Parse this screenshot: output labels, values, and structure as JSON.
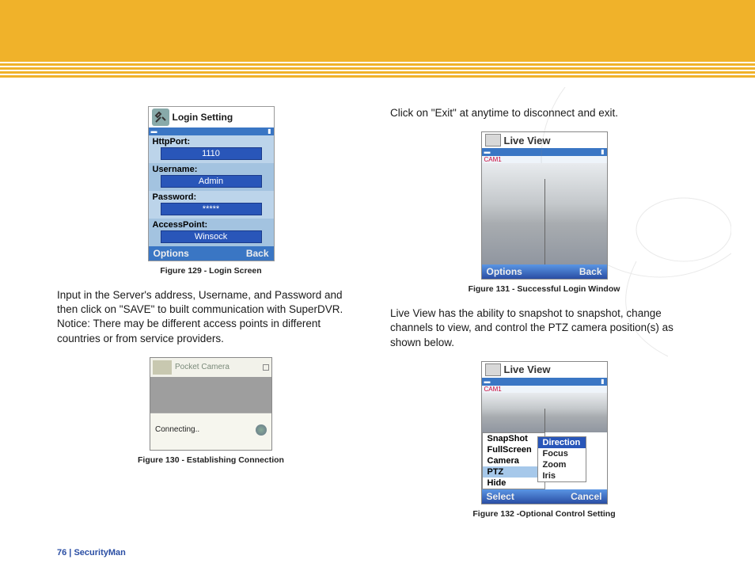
{
  "figures": {
    "f129": {
      "caption": "Figure 129 -  Login Screen",
      "title": "Login Setting",
      "rows": {
        "port_label": "HttpPort:",
        "port_value": "1110",
        "user_label": "Username:",
        "user_value": "Admin",
        "pass_label": "Password:",
        "pass_value": "*****",
        "ap_label": "AccessPoint:",
        "ap_value": "Winsock"
      },
      "softkeys": {
        "left": "Options",
        "right": "Back"
      }
    },
    "f130": {
      "caption": "Figure 130 - Establishing Connection",
      "app_title": "Pocket Camera",
      "status": "Connecting.."
    },
    "f131": {
      "caption": "Figure 131 - Successful Login Window",
      "title": "Live View",
      "cam_label": "CAM1",
      "softkeys": {
        "left": "Options",
        "right": "Back"
      }
    },
    "f132": {
      "caption": "Figure 132 -Optional Control Setting",
      "title": "Live View",
      "cam_label": "CAM1",
      "menu": [
        "SnapShot",
        "FullScreen",
        "Camera",
        "PTZ",
        "Hide"
      ],
      "submenu": [
        "Direction",
        "Focus",
        "Zoom",
        "Iris"
      ],
      "softkeys": {
        "left": "Select",
        "right": "Cancel"
      }
    }
  },
  "text": {
    "p1": "Input in the Server's address, Username, and Password and then click on \"SAVE\" to built communication with SuperDVR. Notice: There may be different access points in different countries or from service providers.",
    "p2": "Click on \"Exit\" at anytime to disconnect and exit.",
    "p3": "Live View has the ability to snapshot to snapshot, change channels to view, and control the PTZ camera position(s) as shown below."
  },
  "footer": {
    "page_number": "76",
    "separator": "  |  ",
    "brand": "SecurityMan"
  }
}
